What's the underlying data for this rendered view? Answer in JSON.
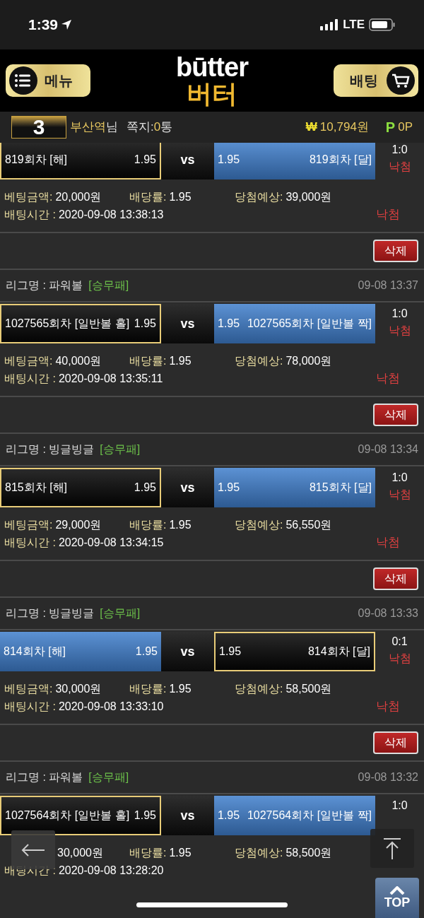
{
  "status_bar": {
    "time": "1:39",
    "network": "LTE"
  },
  "header": {
    "menu_button": "메뉴",
    "logo_top": "būtter",
    "logo_bottom": "버터",
    "bet_button": "배팅"
  },
  "user_bar": {
    "level": "3",
    "user": "부산역",
    "honorific": "님",
    "messages_label": "쪽지:",
    "messages_count": "0",
    "messages_unit": "통",
    "currency": "₩",
    "balance": "10,794원",
    "points_icon": "P",
    "points": "0P"
  },
  "bets": [
    {
      "match": {
        "home": {
          "label": "819회차 [해]",
          "odds": "1.95",
          "selected": true
        },
        "vs": "vs",
        "away": {
          "odds": "1.95",
          "label": "819회차 [달]",
          "selected": false
        },
        "score": "1:0",
        "score_result": "낙첨"
      },
      "details": [
        {
          "label": "베팅금액:",
          "value": "20,000원"
        },
        {
          "label": "배당률:",
          "value": "1.95"
        },
        {
          "label": "당첨예상:",
          "value": "39,000원"
        }
      ],
      "time_label": "배팅시간 :",
      "time": "2020-09-08 13:38:13",
      "result": "낙첨",
      "delete": "삭제"
    },
    {
      "league": "리그명 : 파워볼",
      "tag": "[승무패]",
      "date": "09-08 13:37",
      "match": {
        "home": {
          "label": "1027565회차 [일반볼 홀]",
          "odds": "1.95",
          "selected": true
        },
        "vs": "vs",
        "away": {
          "odds": "1.95",
          "label": "1027565회차 [일반볼 짝]",
          "selected": false
        },
        "score": "1:0",
        "score_result": "낙첨"
      },
      "details": [
        {
          "label": "베팅금액:",
          "value": "40,000원"
        },
        {
          "label": "배당률:",
          "value": "1.95"
        },
        {
          "label": "당첨예상:",
          "value": "78,000원"
        }
      ],
      "time_label": "배팅시간 :",
      "time": "2020-09-08 13:35:11",
      "result": "낙첨",
      "delete": "삭제"
    },
    {
      "league": "리그명 : 빙글빙글",
      "tag": "[승무패]",
      "date": "09-08 13:34",
      "match": {
        "home": {
          "label": "815회차 [해]",
          "odds": "1.95",
          "selected": true
        },
        "vs": "vs",
        "away": {
          "odds": "1.95",
          "label": "815회차 [달]",
          "selected": false
        },
        "score": "1:0",
        "score_result": "낙첨"
      },
      "details": [
        {
          "label": "베팅금액:",
          "value": "29,000원"
        },
        {
          "label": "배당률:",
          "value": "1.95"
        },
        {
          "label": "당첨예상:",
          "value": "56,550원"
        }
      ],
      "time_label": "배팅시간 :",
      "time": "2020-09-08 13:34:15",
      "result": "낙첨",
      "delete": "삭제"
    },
    {
      "league": "리그명 : 빙글빙글",
      "tag": "[승무패]",
      "date": "09-08 13:33",
      "match": {
        "home": {
          "label": "814회차 [해]",
          "odds": "1.95",
          "selected": false
        },
        "vs": "vs",
        "away": {
          "odds": "1.95",
          "label": "814회차 [달]",
          "selected": true
        },
        "score": "0:1",
        "score_result": "낙첨"
      },
      "details": [
        {
          "label": "베팅금액:",
          "value": "30,000원"
        },
        {
          "label": "배당률:",
          "value": "1.95"
        },
        {
          "label": "당첨예상:",
          "value": "58,500원"
        }
      ],
      "time_label": "배팅시간 :",
      "time": "2020-09-08 13:33:10",
      "result": "낙첨",
      "delete": "삭제"
    },
    {
      "league": "리그명 : 파워볼",
      "tag": "[승무패]",
      "date": "09-08 13:32",
      "match": {
        "home": {
          "label": "1027564회차 [일반볼 홀]",
          "odds": "1.95",
          "selected": true
        },
        "vs": "vs",
        "away": {
          "odds": "1.95",
          "label": "1027564회차 [일반볼 짝]",
          "selected": false
        },
        "score": "1:0"
      },
      "details": [
        {
          "value": "30,000원"
        },
        {
          "label": "배당률:",
          "value": "1.95"
        },
        {
          "label": "당첨예상:",
          "value": "58,500원"
        }
      ],
      "time_label": "배팅시간 :",
      "time": "2020-09-08 13:28:20"
    }
  ],
  "top_button": "TOP"
}
